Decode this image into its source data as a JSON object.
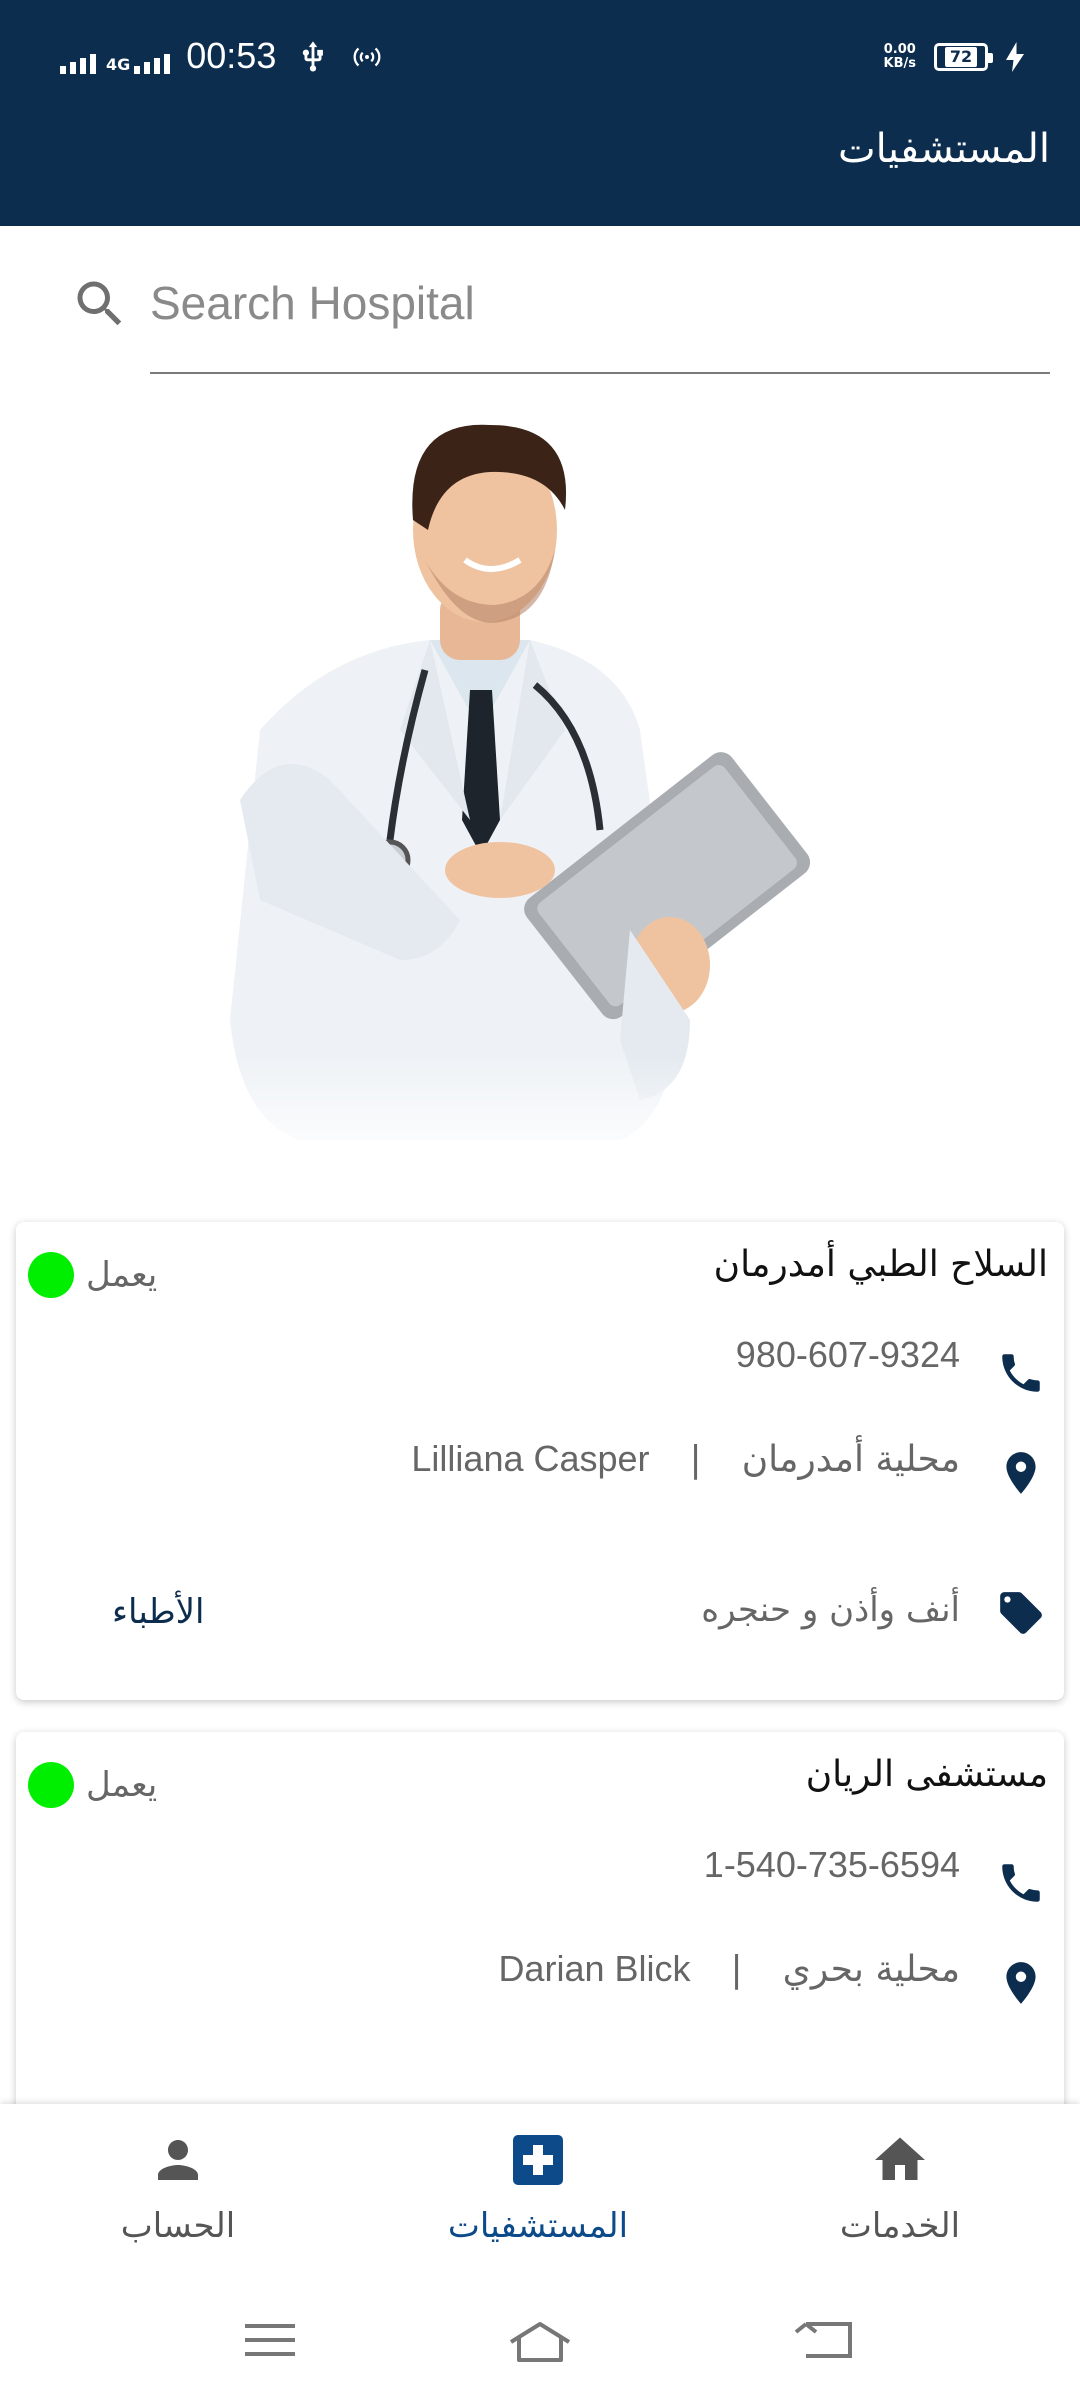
{
  "status_bar": {
    "network": "4G",
    "time": "00:53",
    "speed_value": "0.00",
    "speed_unit": "KB/s",
    "battery": "72"
  },
  "header": {
    "title": "المستشفيات"
  },
  "search": {
    "placeholder": "Search Hospital",
    "value": ""
  },
  "hospitals": [
    {
      "name": "السلاح الطبي أمدرمان",
      "status": "يعمل",
      "status_color": "#00ee00",
      "phone": "980-607-9324",
      "locality": "محلية أمدرمان",
      "contact": "Lilliana Casper",
      "specialty": "أنف وأذن و حنجره",
      "doctors_label": "الأطباء"
    },
    {
      "name": "مستشفى الريان",
      "status": "يعمل",
      "status_color": "#00ee00",
      "phone": "1-540-735-6594",
      "locality": "محلية بحري",
      "contact": "Darian Blick"
    }
  ],
  "bottom_nav": [
    {
      "label": "الحساب",
      "icon": "person-icon",
      "active": false
    },
    {
      "label": "المستشفيات",
      "icon": "medical-cross-icon",
      "active": true
    },
    {
      "label": "الخدمات",
      "icon": "home-icon",
      "active": false
    }
  ],
  "colors": {
    "primary": "#0c2d4e",
    "accent": "#0c4a8a",
    "status_active": "#00ee00"
  }
}
